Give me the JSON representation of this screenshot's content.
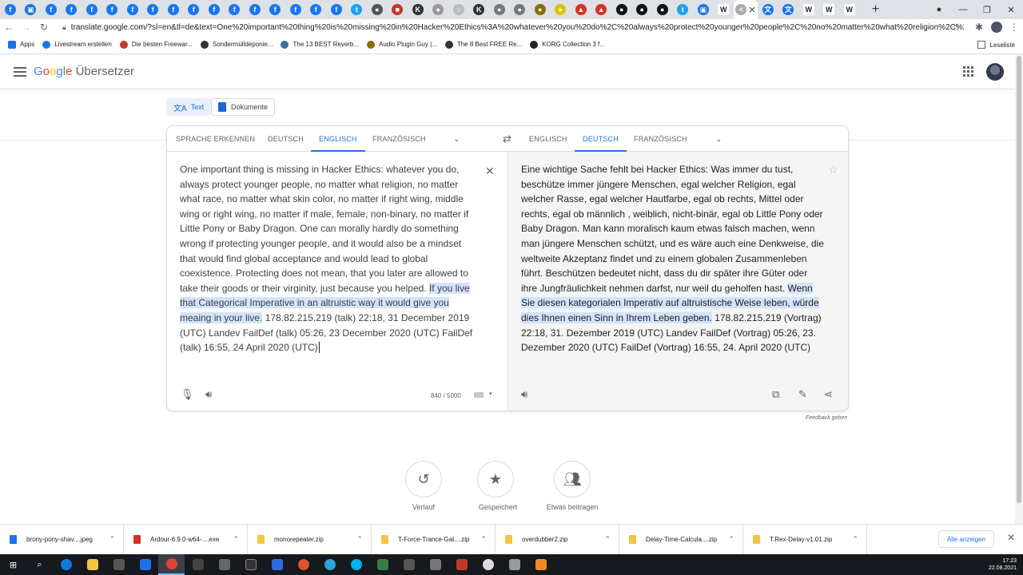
{
  "browser": {
    "tabs": [
      {
        "icon": "facebook-icon",
        "color": "#1877f2",
        "glyph": "f"
      },
      {
        "icon": "image-tab-icon",
        "color": "#1a73e8",
        "glyph": "▣"
      },
      {
        "icon": "facebook-icon",
        "color": "#1877f2",
        "glyph": "f"
      },
      {
        "icon": "facebook-icon",
        "color": "#1877f2",
        "glyph": "f"
      },
      {
        "icon": "facebook-icon",
        "color": "#1877f2",
        "glyph": "f"
      },
      {
        "icon": "facebook-icon",
        "color": "#1877f2",
        "glyph": "f"
      },
      {
        "icon": "facebook-icon",
        "color": "#1877f2",
        "glyph": "f"
      },
      {
        "icon": "facebook-icon",
        "color": "#1877f2",
        "glyph": "f"
      },
      {
        "icon": "facebook-icon",
        "color": "#1877f2",
        "glyph": "f"
      },
      {
        "icon": "facebook-icon",
        "color": "#1877f2",
        "glyph": "f"
      },
      {
        "icon": "facebook-icon",
        "color": "#1877f2",
        "glyph": "f"
      },
      {
        "icon": "facebook-icon",
        "color": "#1877f2",
        "glyph": "f"
      },
      {
        "icon": "facebook-icon",
        "color": "#1877f2",
        "glyph": "f"
      },
      {
        "icon": "facebook-icon",
        "color": "#1877f2",
        "glyph": "f"
      },
      {
        "icon": "facebook-icon",
        "color": "#1877f2",
        "glyph": "f"
      },
      {
        "icon": "facebook-icon",
        "color": "#1877f2",
        "glyph": "f"
      },
      {
        "icon": "facebook-icon",
        "color": "#1877f2",
        "glyph": "f"
      },
      {
        "icon": "twitter-icon",
        "color": "#1da1f2",
        "glyph": "t"
      },
      {
        "icon": "site-icon",
        "color": "#555555",
        "glyph": "●"
      },
      {
        "icon": "site-icon",
        "color": "#c0392b",
        "glyph": "■"
      },
      {
        "icon": "site-icon",
        "color": "#333333",
        "glyph": "K"
      },
      {
        "icon": "site-icon",
        "color": "#999999",
        "glyph": "●"
      },
      {
        "icon": "site-icon",
        "color": "#bbbbbb",
        "glyph": "○"
      },
      {
        "icon": "site-icon",
        "color": "#333333",
        "glyph": "K"
      },
      {
        "icon": "site-icon",
        "color": "#777777",
        "glyph": "●"
      },
      {
        "icon": "site-icon",
        "color": "#777777",
        "glyph": "●"
      },
      {
        "icon": "site-icon",
        "color": "#8a6d00",
        "glyph": "●"
      },
      {
        "icon": "site-icon",
        "color": "#e0c000",
        "glyph": "●"
      },
      {
        "icon": "ardour-icon",
        "color": "#d93025",
        "glyph": "▲"
      },
      {
        "icon": "ardour-icon",
        "color": "#d93025",
        "glyph": "▲"
      },
      {
        "icon": "github-icon",
        "color": "#111111",
        "glyph": "●"
      },
      {
        "icon": "github-icon",
        "color": "#111111",
        "glyph": "●"
      },
      {
        "icon": "github-icon",
        "color": "#111111",
        "glyph": "●"
      },
      {
        "icon": "twitter-icon",
        "color": "#1da1f2",
        "glyph": "t"
      },
      {
        "icon": "site-icon",
        "color": "#1a73e8",
        "glyph": "▣"
      },
      {
        "icon": "wikipedia-icon",
        "color": "#ffffff",
        "glyph": "W"
      },
      {
        "icon": "site-icon",
        "color": "#aaaaaa",
        "glyph": "<"
      },
      {
        "icon": "translate-icon",
        "color": "#1a73e8",
        "glyph": "文"
      },
      {
        "icon": "translate-icon",
        "color": "#1a73e8",
        "glyph": "文"
      },
      {
        "icon": "wikipedia-icon",
        "color": "#ffffff",
        "glyph": "W"
      },
      {
        "icon": "wikipedia-icon",
        "color": "#ffffff",
        "glyph": "W"
      },
      {
        "icon": "wikipedia-icon",
        "color": "#ffffff",
        "glyph": "W"
      }
    ],
    "address": "translate.google.com/?sl=en&tl=de&text=One%20important%20thing%20is%20missing%20in%20Hacker%20Ethics%3A%20whatever%20you%20do%2C%20always%20protect%20younger%20people%2C%20no%20matter%20what%20religion%2C%20no%20mat...",
    "bookmarks": [
      {
        "label": "Apps",
        "color": "#1a73e8"
      },
      {
        "label": "Livestream erstellen",
        "color": "#1877f2"
      },
      {
        "label": "Die besten Freewar...",
        "color": "#c0392b"
      },
      {
        "label": "Sondermülldeponie...",
        "color": "#333333"
      },
      {
        "label": "The 13 BEST Reverb...",
        "color": "#3a6ea5"
      },
      {
        "label": "Audio Plugin Guy |...",
        "color": "#8a6d00"
      },
      {
        "label": "The 8 Best FREE Re...",
        "color": "#333333"
      },
      {
        "label": "KORG Collection 3 f...",
        "color": "#222222"
      }
    ],
    "reading_list": "Leseliste"
  },
  "app": {
    "logo_word": "Google",
    "product": "Übersetzer",
    "modes": {
      "text": "Text",
      "documents": "Dokumente"
    },
    "source_langs": [
      "SPRACHE ERKENNEN",
      "DEUTSCH",
      "ENGLISCH",
      "FRANZÖSISCH"
    ],
    "target_langs": [
      "ENGLISCH",
      "DEUTSCH",
      "FRANZÖSISCH"
    ],
    "source_text_a": "One important thing is missing in Hacker Ethics: whatever you do, always protect younger people, no matter what religion, no matter what race, no matter what skin color, no matter if right wing, middle wing or right wing, no matter if male, female, non-binary, no matter if Little Pony or Baby Dragon. One can morally hardly do something wrong if protecting younger people, and it would also be a mindset that would find global acceptance and would lead to global coexistence. Protecting does not mean, that you later are allowed to take their goods or their virginity, just because you helped. ",
    "source_text_hl": "If you live that Categorical Imperative in an altruistic way it would give you meaing in your live.",
    "source_text_b": " 178.82.215.219 (talk) 22:18, 31 December 2019 (UTC) Landev FailDef (talk) 05:26, 23 December 2020 (UTC) FailDef (talk) 16:55, 24 April 2020 (UTC)",
    "target_text_a": "Eine wichtige Sache fehlt bei Hacker Ethics: Was immer du tust, beschütze immer jüngere Menschen, egal welcher Religion, egal welcher Rasse, egal welcher Hautfarbe, egal ob rechts, Mittel oder rechts, egal ob männlich , weiblich, nicht-binär, egal ob Little Pony oder Baby Dragon. Man kann moralisch kaum etwas falsch machen, wenn man jüngere Menschen schützt, und es wäre auch eine Denkweise, die weltweite Akzeptanz findet und zu einem globalen Zusammenleben führt. Beschützen bedeutet nicht, dass du dir später ihre Güter oder ihre Jungfräulichkeit nehmen darfst, nur weil du geholfen hast. ",
    "target_text_hl": "Wenn Sie diesen kategorialen Imperativ auf altruistische Weise leben, würde dies Ihnen einen Sinn in Ihrem Leben geben.",
    "target_text_b": " 178.82.215.219 (Vortrag) 22:18, 31. Dezember 2019 (UTC) Landev FailDef (Vortrag) 05:26, 23. Dezember 2020 (UTC) FailDef (Vortrag) 16:55, 24. April 2020 (UTC)",
    "char_count": "840 / 5000",
    "feedback": "Feedback geben",
    "history": "Verlauf",
    "saved": "Gespeichert",
    "contribute": "Etwas beitragen"
  },
  "downloads": [
    {
      "name": "brony-pony-shav....jpeg",
      "color": "#1a73e8"
    },
    {
      "name": "Ardour-6.9.0-w64-....exe",
      "color": "#d93025"
    },
    {
      "name": "monorepeater.zip",
      "color": "#f4c542"
    },
    {
      "name": "T-Force-Trance-Gat....zip",
      "color": "#f4c542"
    },
    {
      "name": "overdubber2.zip",
      "color": "#f4c542"
    },
    {
      "name": "Delay-Time-Calcula....zip",
      "color": "#f4c542"
    },
    {
      "name": "T.Rex-Delay-v1.01.zip",
      "color": "#f4c542"
    }
  ],
  "show_all": "Alle anzeigen",
  "taskbar": {
    "time": "17:23",
    "date": "22.08.2021"
  }
}
